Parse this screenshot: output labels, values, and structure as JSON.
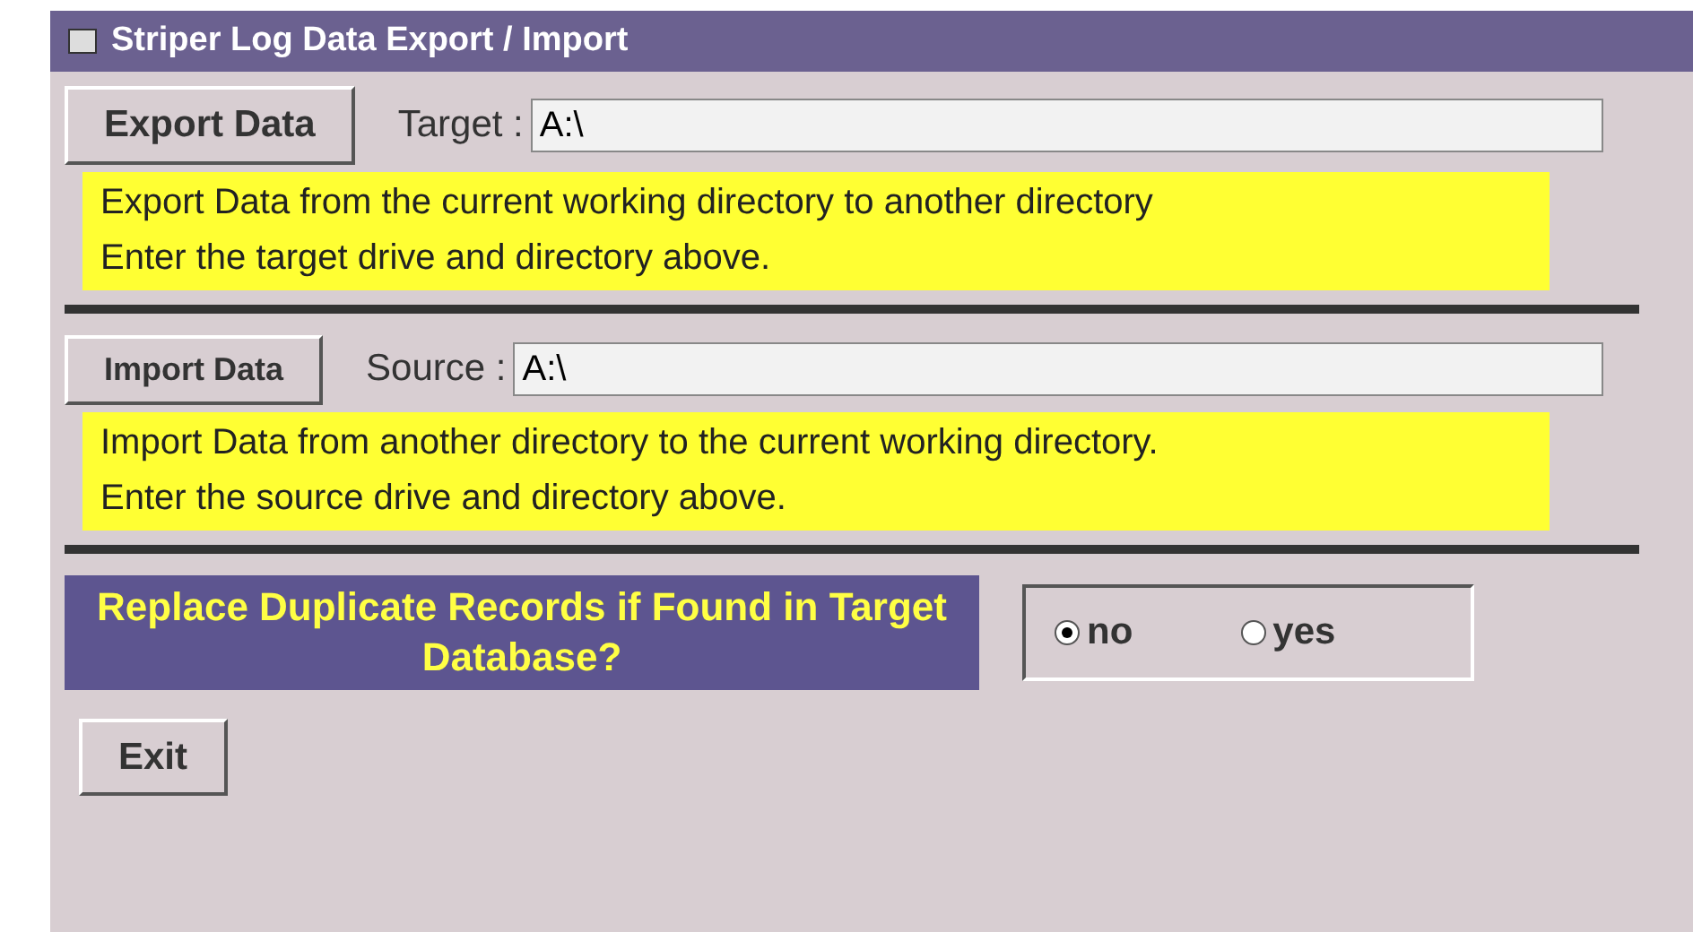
{
  "window": {
    "title": "Striper Log Data Export / Import"
  },
  "sections": [
    {
      "button": "Export Data",
      "field_label": "Target :",
      "field_value": "A:\\",
      "note": [
        "Export Data from the current working directory to another directory",
        "Enter the target drive and directory above."
      ]
    },
    {
      "button": "Import Data",
      "field_label": "Source :",
      "field_value": "A:\\",
      "note": [
        "Import Data from another directory to the current working directory.",
        "Enter the source drive and directory above."
      ]
    }
  ],
  "replace_question": "Replace Duplicate Records if Found in Target Database?",
  "replace_options": [
    {
      "label": "no",
      "selected": true
    },
    {
      "label": "yes",
      "selected": false
    }
  ],
  "exit_button": "Exit"
}
